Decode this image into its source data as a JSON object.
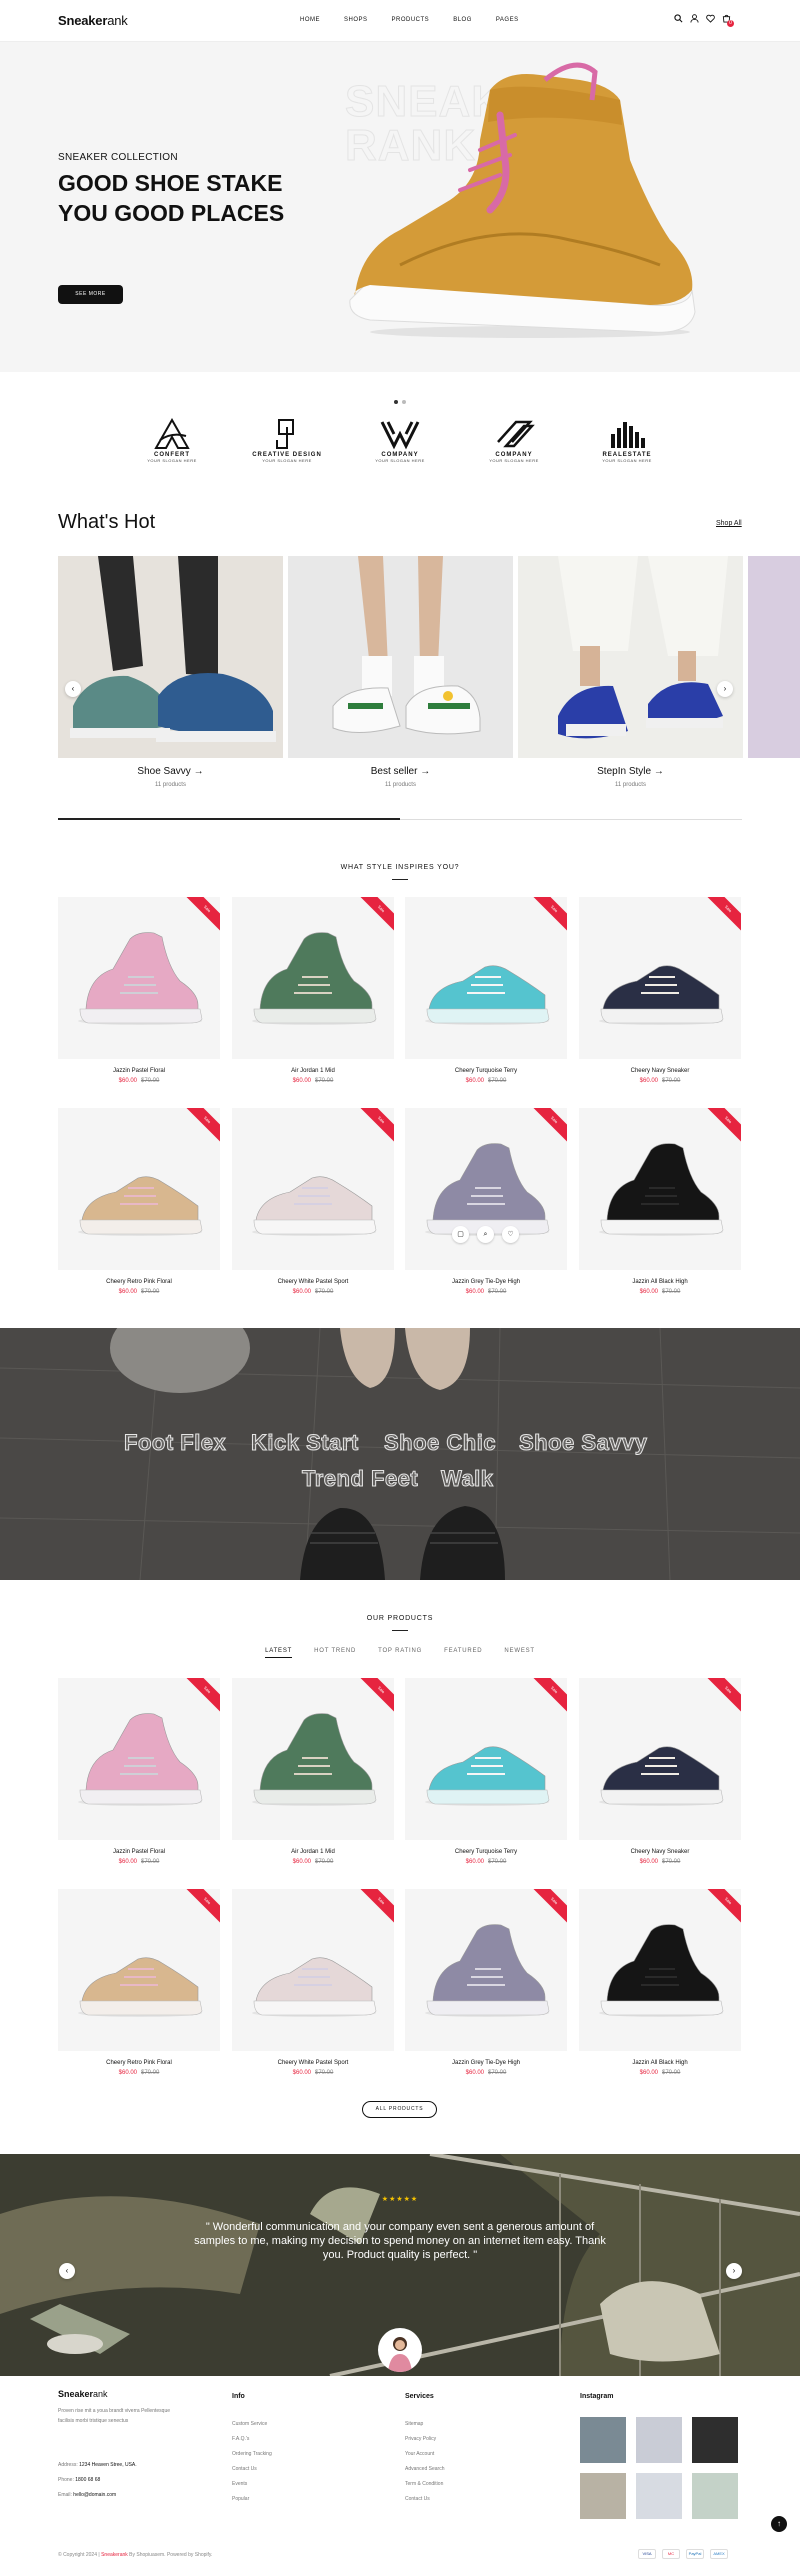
{
  "header": {
    "logo_bold": "Sneaker",
    "logo_light": "ank",
    "nav": [
      "HOME",
      "SHOPS",
      "PRODUCTS",
      "BLOG",
      "PAGES"
    ],
    "icons": [
      "search-icon",
      "user-icon",
      "heart-icon",
      "cart-icon"
    ],
    "cart_count": "0"
  },
  "hero": {
    "eyebrow": "SNEAKER COLLECTION",
    "title": "GOOD SHOE STAKE YOU GOOD PLACES",
    "button": "SEE MORE",
    "watermark_line1": "SNEAKE",
    "watermark_line2": "RANK"
  },
  "brands": [
    {
      "title": "CONFERT",
      "subtitle": "YOUR SLOGAN HERE"
    },
    {
      "title": "CREATIVE DESIGN",
      "subtitle": "YOUR SLOGAN HERE"
    },
    {
      "title": "COMPANY",
      "subtitle": "YOUR SLOGAN HERE"
    },
    {
      "title": "COMPANY",
      "subtitle": "YOUR SLOGAN HERE"
    },
    {
      "title": "REALESTATE",
      "subtitle": "YOUR SLOGAN HERE"
    }
  ],
  "hot": {
    "title": "What's Hot",
    "shop_all": "Shop All",
    "progress": 0.5,
    "cards": [
      {
        "label": "Shoe Savvy →",
        "count": "11 products"
      },
      {
        "label": "Best seller →",
        "count": "11 products"
      },
      {
        "label": "StepIn Style →",
        "count": "11 products"
      }
    ]
  },
  "inspire": {
    "eyebrow": "WHAT STYLE INSPIRES YOU?"
  },
  "ribbon_label": "Sale",
  "products": [
    {
      "name": "Jazzin Pastel Floral",
      "sale": "$60.00",
      "orig": "$70.00"
    },
    {
      "name": "Air Jordan 1 Mid",
      "sale": "$60.00",
      "orig": "$70.00"
    },
    {
      "name": "Cheery Turquoise Terry",
      "sale": "$60.00",
      "orig": "$70.00"
    },
    {
      "name": "Cheery Navy Sneaker",
      "sale": "$60.00",
      "orig": "$70.00"
    },
    {
      "name": "Cheery Retro Pink Floral",
      "sale": "$60.00",
      "orig": "$70.00"
    },
    {
      "name": "Cheery White Pastel Sport",
      "sale": "$60.00",
      "orig": "$70.00"
    },
    {
      "name": "Jazzin Grey Tie-Dye High",
      "sale": "$60.00",
      "orig": "$70.00"
    },
    {
      "name": "Jazzin All Black High",
      "sale": "$60.00",
      "orig": "$70.00"
    }
  ],
  "banner_words": [
    "Foot Flex",
    "Kick Start",
    "Shoe Chic",
    "Shoe Savvy",
    "Trend Feet",
    "Walk"
  ],
  "our_products": {
    "eyebrow": "OUR PRODUCTS",
    "tabs": [
      "LATEST",
      "HOT TREND",
      "TOP RATING",
      "FEATURED",
      "NEWEST"
    ],
    "all_button": "ALL PRODUCTS"
  },
  "testimonial": {
    "stars": "★★★★★",
    "text": "\" Wonderful communication and your company even sent a generous amount of samples to me, making my decision to spend money on an internet item easy. Thank you. Product quality is perfect. \""
  },
  "footer": {
    "logo_bold": "Sneaker",
    "logo_light": "ank",
    "about": "Proven rise mit a youa brandt viverra Pellentesque facilisis morbi tristique senectus",
    "address_label": "Address:",
    "address": "1234 Heaven Stree, USA.",
    "phone_label": "Phone:",
    "phone": "1800 68 68",
    "email_label": "Email:",
    "email": "hello@domain.com",
    "info_title": "Info",
    "info_links": [
      "Custom Service",
      "F.A.Q.'s",
      "Ordering Tracking",
      "Contact Us",
      "Events",
      "Popular"
    ],
    "services_title": "Services",
    "services_links": [
      "Sitemap",
      "Privacy Policy",
      "Your Account",
      "Advanced Search",
      "Term & Condition",
      "Contact Us"
    ],
    "instagram_title": "Instagram",
    "copyright_pre": "© Copyright 2024 |",
    "copyright_brand": "Sneakerank",
    "copyright_mid": "By Shopiuasem. Powered by Shopify.",
    "payments": [
      "VISA",
      "MC",
      "PayPal",
      "AMEX"
    ]
  },
  "colors": {
    "accent": "#e6243f",
    "dark": "#111111",
    "hero_bg": "#f5f5f5",
    "star": "#f5c200"
  }
}
